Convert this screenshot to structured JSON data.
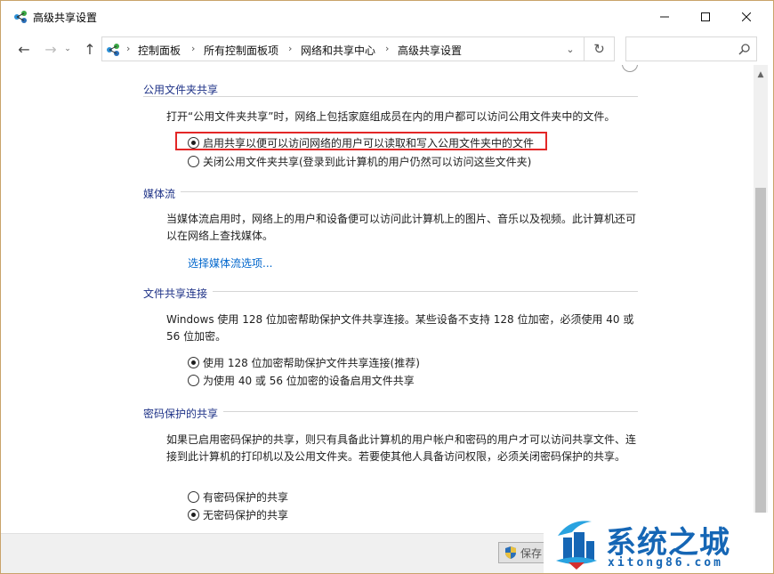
{
  "window": {
    "title": "高级共享设置",
    "controls": {
      "minimize": "—",
      "maximize": "☐",
      "close": "✕"
    }
  },
  "nav": {
    "back": "←",
    "forward": "→",
    "recent": "⌄",
    "up": "↑",
    "breadcrumbs": [
      "控制面板",
      "所有控制面板项",
      "网络和共享中心",
      "高级共享设置"
    ],
    "separator": "›",
    "dropdown": "⌄",
    "refresh": "↻",
    "search_placeholder": ""
  },
  "sections": {
    "public_folder": {
      "heading": "公用文件夹共享",
      "description": "打开“公用文件夹共享”时，网络上包括家庭组成员在内的用户都可以访问公用文件夹中的文件。",
      "options": [
        {
          "label": "启用共享以便可以访问网络的用户可以读取和写入公用文件夹中的文件",
          "checked": true
        },
        {
          "label": "关闭公用文件夹共享(登录到此计算机的用户仍然可以访问这些文件夹)",
          "checked": false
        }
      ]
    },
    "media_streaming": {
      "heading": "媒体流",
      "description": "当媒体流启用时，网络上的用户和设备便可以访问此计算机上的图片、音乐以及视频。此计算机还可以在网络上查找媒体。",
      "link": "选择媒体流选项..."
    },
    "file_sharing": {
      "heading": "文件共享连接",
      "description": "Windows 使用 128 位加密帮助保护文件共享连接。某些设备不支持 128 位加密，必须使用 40 或 56 位加密。",
      "options": [
        {
          "label": "使用 128 位加密帮助保护文件共享连接(推荐)",
          "checked": true
        },
        {
          "label": "为使用 40 或 56 位加密的设备启用文件共享",
          "checked": false
        }
      ]
    },
    "password": {
      "heading": "密码保护的共享",
      "description": "如果已启用密码保护的共享，则只有具备此计算机的用户帐户和密码的用户才可以访问共享文件、连接到此计算机的打印机以及公用文件夹。若要使其他人具备访问权限，必须关闭密码保护的共享。",
      "options": [
        {
          "label": "有密码保护的共享",
          "checked": false
        },
        {
          "label": "无密码保护的共享",
          "checked": true
        }
      ]
    }
  },
  "footer": {
    "save_label": "保存"
  },
  "watermark": {
    "title": "系统之城",
    "url": "xitong86.com"
  },
  "colors": {
    "link": "#0066cc",
    "heading": "#1e3287",
    "highlight": "#e32727",
    "watermark": "#1566b5"
  }
}
